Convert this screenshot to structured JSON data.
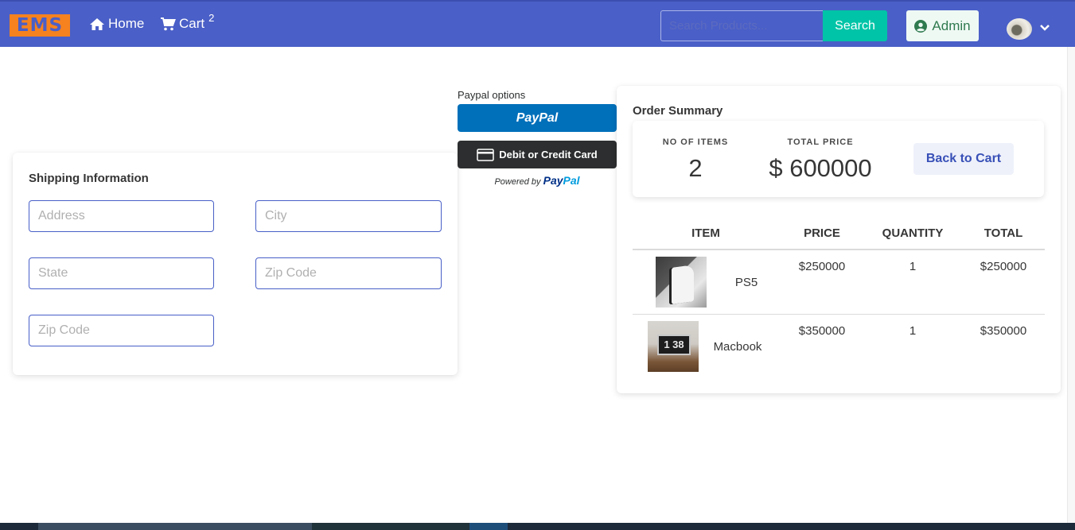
{
  "navbar": {
    "logo": "EMS",
    "home_label": "Home",
    "cart_label": "Cart",
    "cart_count": "2",
    "search_placeholder": "Search Products...",
    "search_button": "Search",
    "admin_label": "Admin",
    "colors": {
      "bar": "#4a5fc7",
      "logo_bg": "#f5821f",
      "search_btn": "#00c4a7"
    }
  },
  "shipping": {
    "title": "Shipping Information",
    "fields": [
      {
        "placeholder": "Address",
        "value": ""
      },
      {
        "placeholder": "City",
        "value": ""
      },
      {
        "placeholder": "State",
        "value": ""
      },
      {
        "placeholder": "Zip Code",
        "value": ""
      },
      {
        "placeholder": "Zip Code",
        "value": ""
      }
    ]
  },
  "paypal": {
    "options_label": "Paypal options",
    "paypal_button": "PayPal",
    "card_button": "Debit or Credit Card",
    "powered_by": "Powered by",
    "brand_pay": "Pay",
    "brand_pal": "Pal"
  },
  "order_summary": {
    "title": "Order Summary",
    "items_label": "NO OF ITEMS",
    "items_value": "2",
    "total_label": "TOTAL PRICE",
    "total_value": "$ 600000",
    "back_button": "Back to Cart",
    "columns": [
      "ITEM",
      "PRICE",
      "QUANTITY",
      "TOTAL"
    ],
    "rows": [
      {
        "name": "PS5",
        "price": "$250000",
        "quantity": "1",
        "total": "$250000",
        "thumb_text": ""
      },
      {
        "name": "Macbook",
        "price": "$350000",
        "quantity": "1",
        "total": "$350000",
        "thumb_text": "1 38"
      }
    ]
  }
}
